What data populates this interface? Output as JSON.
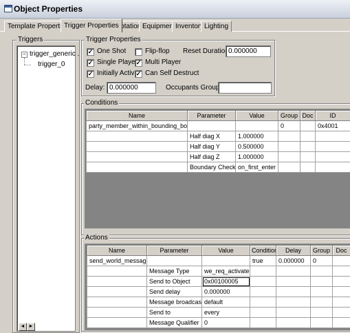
{
  "window": {
    "title": "Object Properties"
  },
  "tabs": [
    "Template Properties",
    "Trigger Properties",
    "Rotation",
    "Equipment",
    "Inventory",
    "Lighting"
  ],
  "triggers": {
    "title": "Triggers",
    "root_label": "trigger_generic .",
    "child_label": "trigger_0"
  },
  "trigger_properties": {
    "title": "Trigger Properties",
    "one_shot": {
      "label": "One Shot",
      "checked": true
    },
    "flip_flop": {
      "label": "Flip-flop",
      "checked": false
    },
    "single_player": {
      "label": "Single Player",
      "checked": true
    },
    "multi_player": {
      "label": "Multi Player",
      "checked": true
    },
    "initially_active": {
      "label": "Initially Active",
      "checked": true
    },
    "can_self_destruct": {
      "label": "Can Self Destruct",
      "checked": true
    },
    "reset_duration_label": "Reset Duration:",
    "reset_duration_value": "0.000000",
    "delay_label": "Delay:",
    "delay_value": "0.000000",
    "occupants_group_label": "Occupants Group:",
    "occupants_group_value": ""
  },
  "conditions": {
    "title": "Conditions",
    "columns": [
      "Name",
      "Parameter",
      "Value",
      "Group",
      "Doc",
      "ID"
    ],
    "rows": [
      [
        "party_member_within_bounding_box",
        "",
        "",
        "0",
        "",
        "0x4001"
      ],
      [
        "",
        "Half diag X",
        "1.000000",
        "",
        "",
        ""
      ],
      [
        "",
        "Half diag Y",
        "0.500000",
        "",
        "",
        ""
      ],
      [
        "",
        "Half diag Z",
        "1.000000",
        "",
        "",
        ""
      ],
      [
        "",
        "Boundary Check",
        "on_first_enter",
        "",
        "",
        ""
      ]
    ]
  },
  "actions": {
    "title": "Actions",
    "columns": [
      "Name",
      "Parameter",
      "Value",
      "Condition",
      "Delay",
      "Group",
      "Doc"
    ],
    "rows": [
      [
        "send_world_message",
        "",
        "",
        "true",
        "0.000000",
        "0",
        ""
      ],
      [
        "",
        "Message Type",
        "we_req_activate",
        "",
        "",
        "",
        ""
      ],
      [
        "",
        "Send to Object",
        "0x00100005",
        "",
        "",
        "",
        ""
      ],
      [
        "",
        "Send delay",
        "0.000000",
        "",
        "",
        "",
        ""
      ],
      [
        "",
        "Message broadcast",
        "default",
        "",
        "",
        "",
        ""
      ],
      [
        "",
        "Send to",
        "every",
        "",
        "",
        "",
        ""
      ],
      [
        "",
        "Message Qualifier",
        "0",
        "",
        "",
        "",
        ""
      ]
    ]
  }
}
